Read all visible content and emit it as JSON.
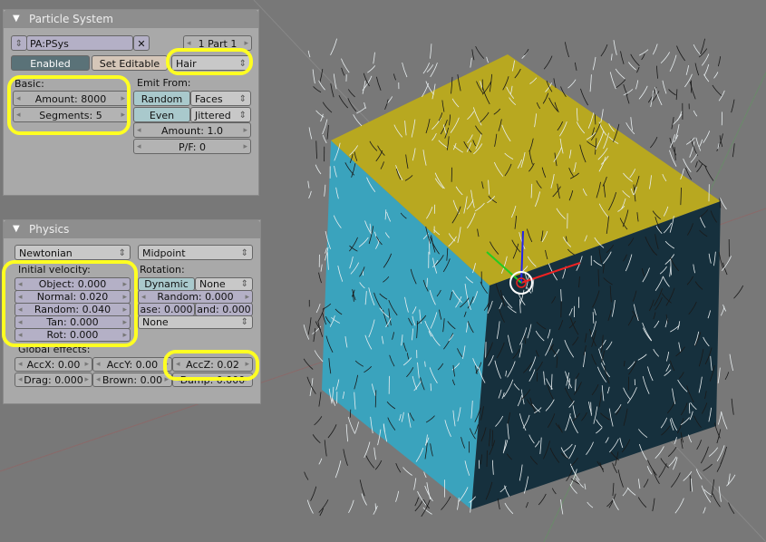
{
  "particle_panel": {
    "title": "Particle System",
    "name_field": "PA:PSys",
    "part_selector": "1 Part 1",
    "enabled_label": "Enabled",
    "set_editable_label": "Set Editable",
    "type_select": "Hair",
    "basic_label": "Basic:",
    "amount": "Amount: 8000",
    "segments": "Segments: 5",
    "emit_from_label": "Emit From:",
    "random_label": "Random",
    "faces_select": "Faces",
    "even_label": "Even",
    "jittered_select": "Jittered",
    "emit_amount": "Amount: 1.0",
    "pf": "P/F: 0"
  },
  "physics_panel": {
    "title": "Physics",
    "physics_type": "Newtonian",
    "integrator": "Midpoint",
    "initial_velocity_label": "Initial velocity:",
    "object": "Object: 0.000",
    "normal": "Normal: 0.020",
    "random": "Random: 0.040",
    "tan": "Tan: 0.000",
    "rot": "Rot: 0.000",
    "rotation_label": "Rotation:",
    "dynamic_label": "Dynamic",
    "rotation_select": "None",
    "rot_random": "Random: 0.000",
    "phase": "ase: 0.000",
    "phase_rand": "and: 0.000",
    "angular_select": "None",
    "global_effects_label": "Global effects:",
    "accx": "AccX: 0.00",
    "accy": "AccY: 0.00",
    "accz": "AccZ: 0.02",
    "drag": "Drag: 0.000",
    "brown": "Brown: 0.00",
    "damp": "Damp: 0.000"
  },
  "colors": {
    "highlight": "#ffff22",
    "top_face": "#b8a820",
    "left_face": "#3aa3bd",
    "right_face": "#16303d"
  }
}
